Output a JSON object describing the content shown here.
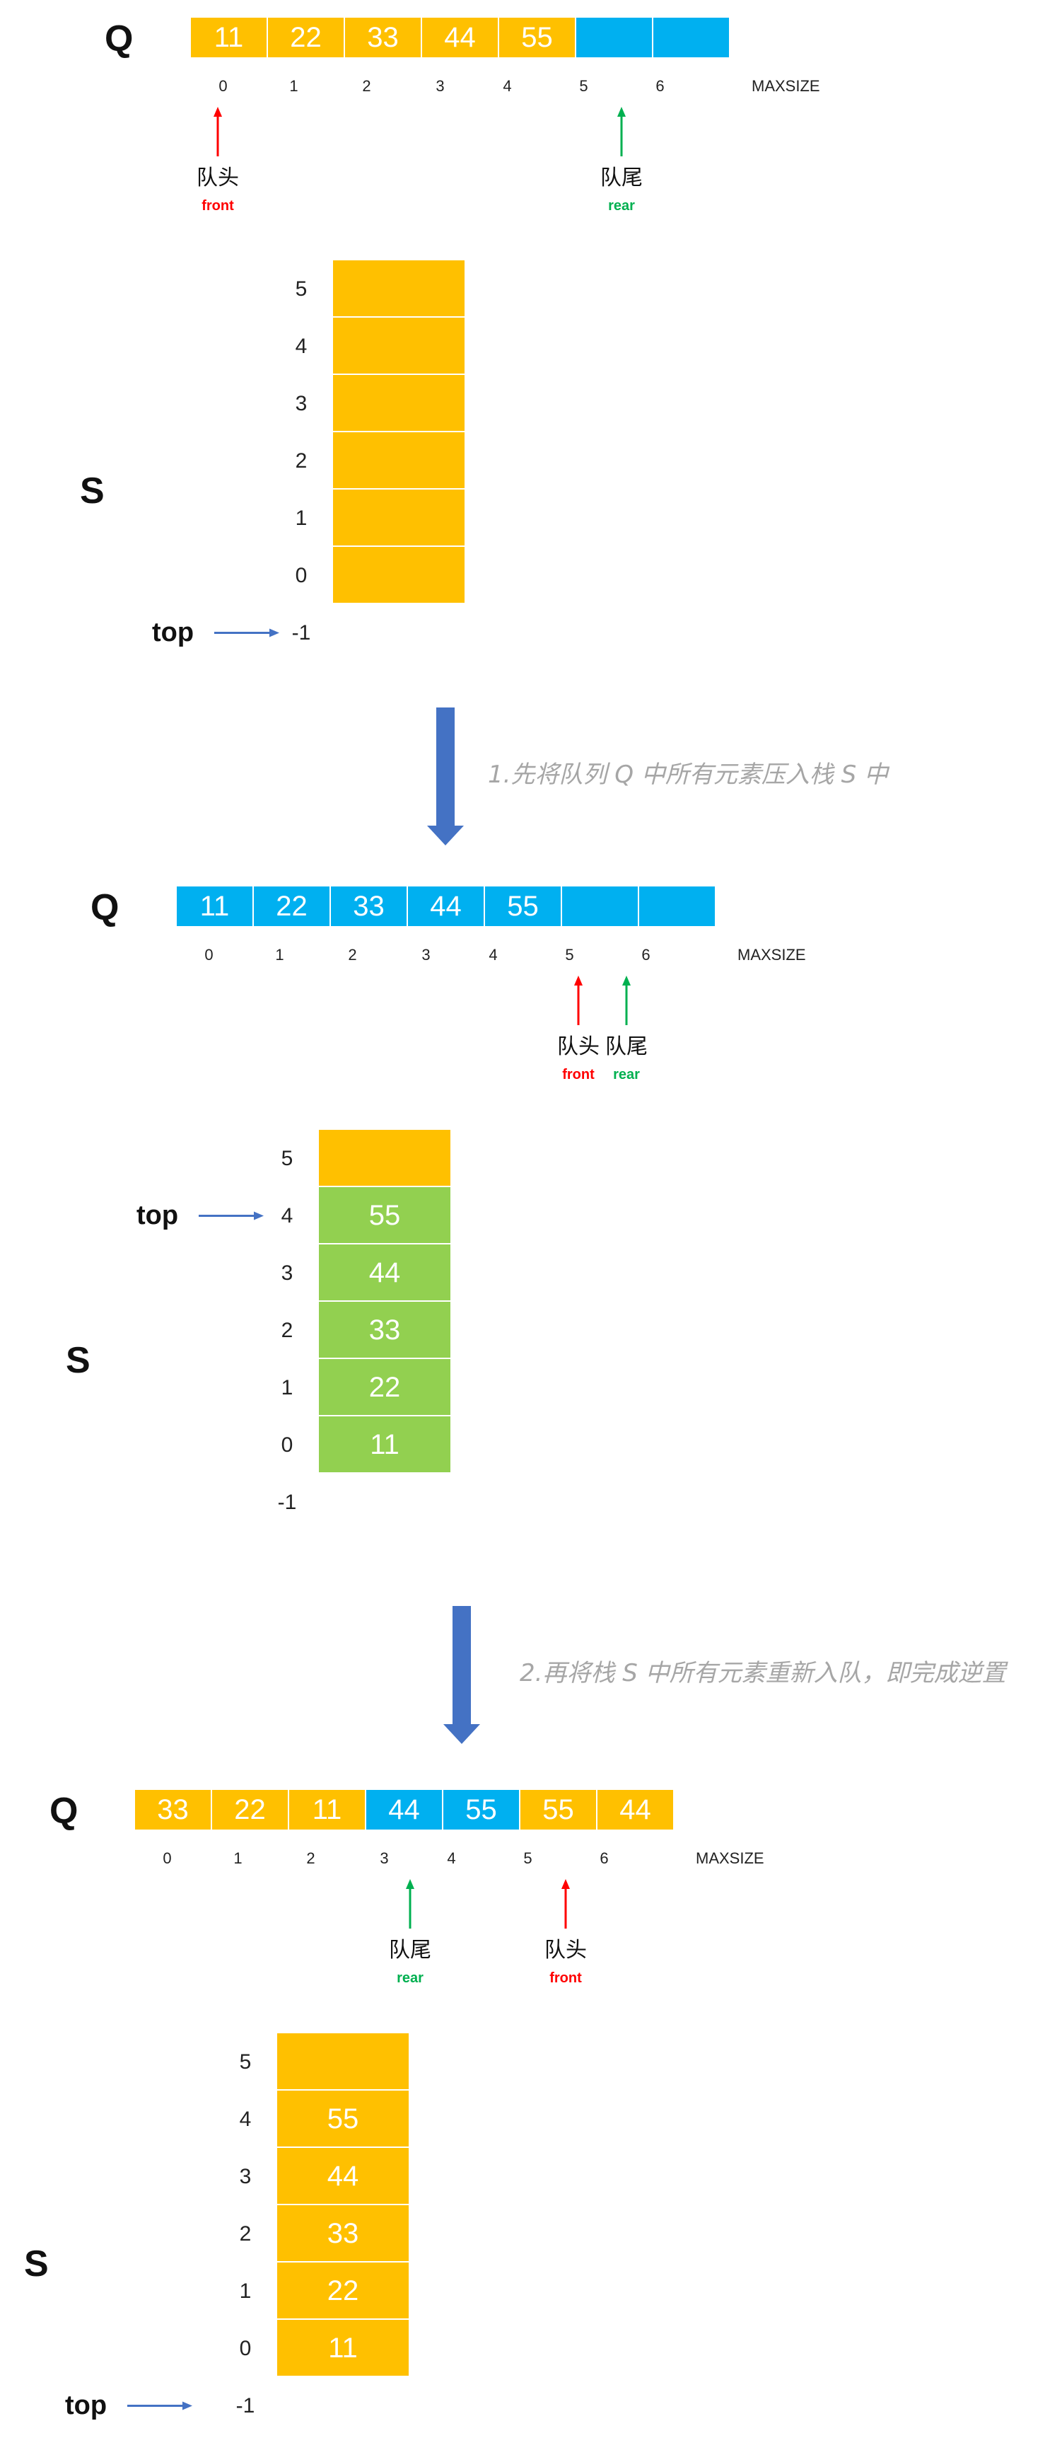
{
  "colors": {
    "filled": "#FFC000",
    "empty_queue": "#00B0F0",
    "stacked": "#92D050",
    "front": "#FF0000",
    "rear": "#00B050",
    "top_arrow": "#4472C4",
    "step_arrow": "#4472C4",
    "step_text": "#A6A6A6"
  },
  "labels": {
    "queue_name": "Q",
    "stack_name": "S",
    "maxsize": "MAXSIZE",
    "top": "top",
    "front_cn": "队头",
    "front_en": "front",
    "rear_cn": "队尾",
    "rear_en": "rear"
  },
  "queue_indices": [
    "0",
    "1",
    "2",
    "3",
    "4",
    "5",
    "6"
  ],
  "stack_indices": [
    "5",
    "4",
    "3",
    "2",
    "1",
    "0",
    "-1"
  ],
  "steps": [
    "1.先将队列 Q 中所有元素压入栈 S 中",
    "2.再将栈 S 中所有元素重新入队，即完成逆置"
  ],
  "stage1": {
    "queue": [
      {
        "value": "11",
        "state": "filled"
      },
      {
        "value": "22",
        "state": "filled"
      },
      {
        "value": "33",
        "state": "filled"
      },
      {
        "value": "44",
        "state": "filled"
      },
      {
        "value": "55",
        "state": "filled"
      },
      {
        "value": "",
        "state": "empty_queue"
      },
      {
        "value": "",
        "state": "empty_queue"
      }
    ],
    "front_index": 0,
    "rear_index": 5,
    "stack": [
      {
        "value": "",
        "state": "filled"
      },
      {
        "value": "",
        "state": "filled"
      },
      {
        "value": "",
        "state": "filled"
      },
      {
        "value": "",
        "state": "filled"
      },
      {
        "value": "",
        "state": "filled"
      },
      {
        "value": "",
        "state": "filled"
      }
    ],
    "top_index": -1
  },
  "stage2": {
    "queue": [
      {
        "value": "11",
        "state": "empty_queue"
      },
      {
        "value": "22",
        "state": "empty_queue"
      },
      {
        "value": "33",
        "state": "empty_queue"
      },
      {
        "value": "44",
        "state": "empty_queue"
      },
      {
        "value": "55",
        "state": "empty_queue"
      },
      {
        "value": "",
        "state": "empty_queue"
      },
      {
        "value": "",
        "state": "empty_queue"
      }
    ],
    "front_index": 5,
    "rear_index": 5,
    "stack": [
      {
        "value": "",
        "state": "filled"
      },
      {
        "value": "55",
        "state": "stacked"
      },
      {
        "value": "44",
        "state": "stacked"
      },
      {
        "value": "33",
        "state": "stacked"
      },
      {
        "value": "22",
        "state": "stacked"
      },
      {
        "value": "11",
        "state": "stacked"
      }
    ],
    "top_index": 4
  },
  "stage3": {
    "queue": [
      {
        "value": "33",
        "state": "filled"
      },
      {
        "value": "22",
        "state": "filled"
      },
      {
        "value": "11",
        "state": "filled"
      },
      {
        "value": "44",
        "state": "empty_queue"
      },
      {
        "value": "55",
        "state": "empty_queue"
      },
      {
        "value": "55",
        "state": "filled"
      },
      {
        "value": "44",
        "state": "filled"
      }
    ],
    "front_index": 5,
    "rear_index": 3,
    "stack": [
      {
        "value": "",
        "state": "filled"
      },
      {
        "value": "55",
        "state": "filled"
      },
      {
        "value": "44",
        "state": "filled"
      },
      {
        "value": "33",
        "state": "filled"
      },
      {
        "value": "22",
        "state": "filled"
      },
      {
        "value": "11",
        "state": "filled"
      }
    ],
    "top_index": -1
  }
}
